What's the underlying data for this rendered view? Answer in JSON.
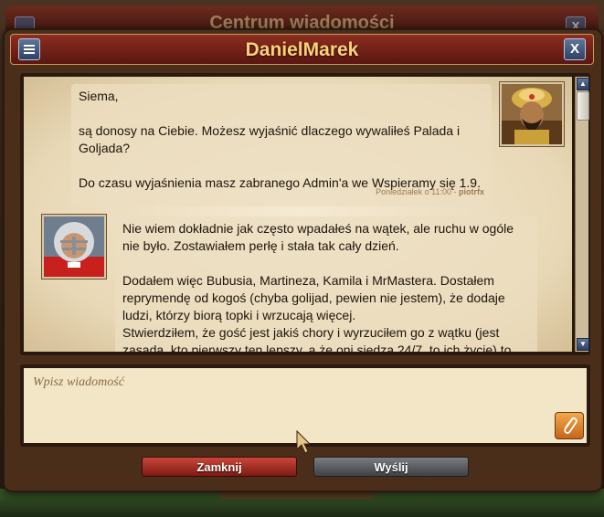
{
  "background_window": {
    "title": "Centrum wiadomości",
    "close_label": "X"
  },
  "dialog": {
    "title": "DanielMarek",
    "close_label": "X"
  },
  "messages": [
    {
      "text": "Siema,\n\nsą donosy na Ciebie. Możesz wyjaśnić dlaczego wywaliłeś Palada i Goljada?\n\nDo czasu wyjaśnienia masz zabranego Admin'a we Wspieramy się 1.9.",
      "timestamp": "Poniedziałek o 11:00 -",
      "author": "piotrfx",
      "avatar": "sultan-avatar"
    },
    {
      "text": "Nie wiem dokładnie jak często wpadałeś na wątek, ale ruchu w ogóle nie było. Zostawiałem perłę i stała tak cały dzień.\n\nDodałem więc Bubusia, Martineza, Kamila i MrMastera. Dostałem reprymendę od kogoś (chyba golijad, pewien nie jestem), że dodaje ludzi, którzy biorą topki i wrzucają więcej.\nStwierdziłem, że gość jest jakiś chory i wyrzuciłem go z wątku (jest zasada, kto pierwszy ten lepszy, a że oni siedzą 24/7, to ich życie) to, że",
      "avatar": "football-player-avatar"
    }
  ],
  "compose": {
    "placeholder": "Wpisz wiadomość"
  },
  "buttons": {
    "close_label": "Zamknij",
    "send_label": "Wyślij"
  },
  "colors": {
    "title_text": "#f7d27a",
    "close_button": "#c9463a",
    "send_button": "#5a5d60",
    "attach_button": "#e08a30"
  }
}
